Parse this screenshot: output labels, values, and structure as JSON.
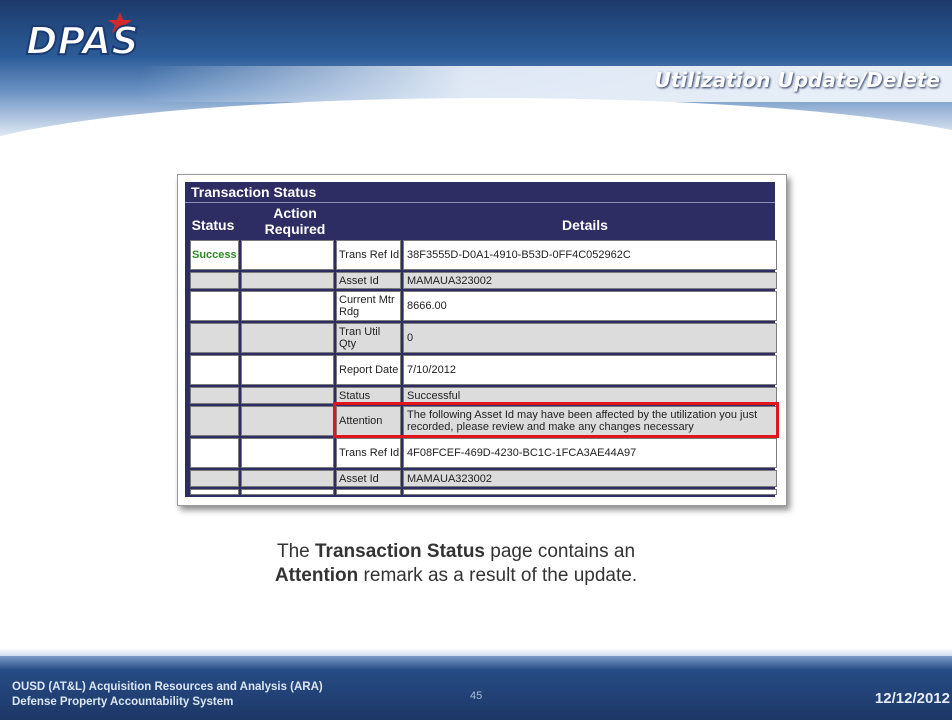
{
  "logo_text": "DPAS",
  "slide_title": "Utilization Update/Delete",
  "pane": {
    "title": "Transaction Status",
    "headers": {
      "status": "Status",
      "action": "Action Required",
      "details": "Details"
    }
  },
  "rows": [
    {
      "status": "Success",
      "label": "Trans Ref Id",
      "value": "38F3555D-D0A1-4910-B53D-0FF4C052962C"
    },
    {
      "status": "",
      "label": "Asset Id",
      "value": "MAMAUA323002"
    },
    {
      "status": "",
      "label": "Current Mtr Rdg",
      "value": "8666.00"
    },
    {
      "status": "",
      "label": "Tran Util Qty",
      "value": "0"
    },
    {
      "status": "",
      "label": "Report Date",
      "value": "7/10/2012"
    },
    {
      "status": "",
      "label": "Status",
      "value": "Successful"
    },
    {
      "status": "",
      "label": "Attention",
      "value": "The following Asset Id may have been affected by the utilization you just recorded, please review and make any changes necessary"
    },
    {
      "status": "",
      "label": "Trans Ref Id",
      "value": "4F08FCEF-469D-4230-BC1C-1FCA3AE44A97"
    },
    {
      "status": "",
      "label": "Asset Id",
      "value": "MAMAUA323002"
    }
  ],
  "caption": {
    "p1": "The ",
    "b1": "Transaction Status",
    "p2": " page contains an",
    "b2": "Attention",
    "p3": " remark as a result of the update."
  },
  "footer": {
    "org_line1": "OUSD (AT&L) Acquisition Resources and Analysis (ARA)",
    "org_line2": "Defense Property Accountability System",
    "page_number": "45",
    "date": "12/12/2012"
  },
  "colors": {
    "pane_bg": "#2d2d64",
    "success": "#2e8b24",
    "highlight": "#e0161c"
  }
}
